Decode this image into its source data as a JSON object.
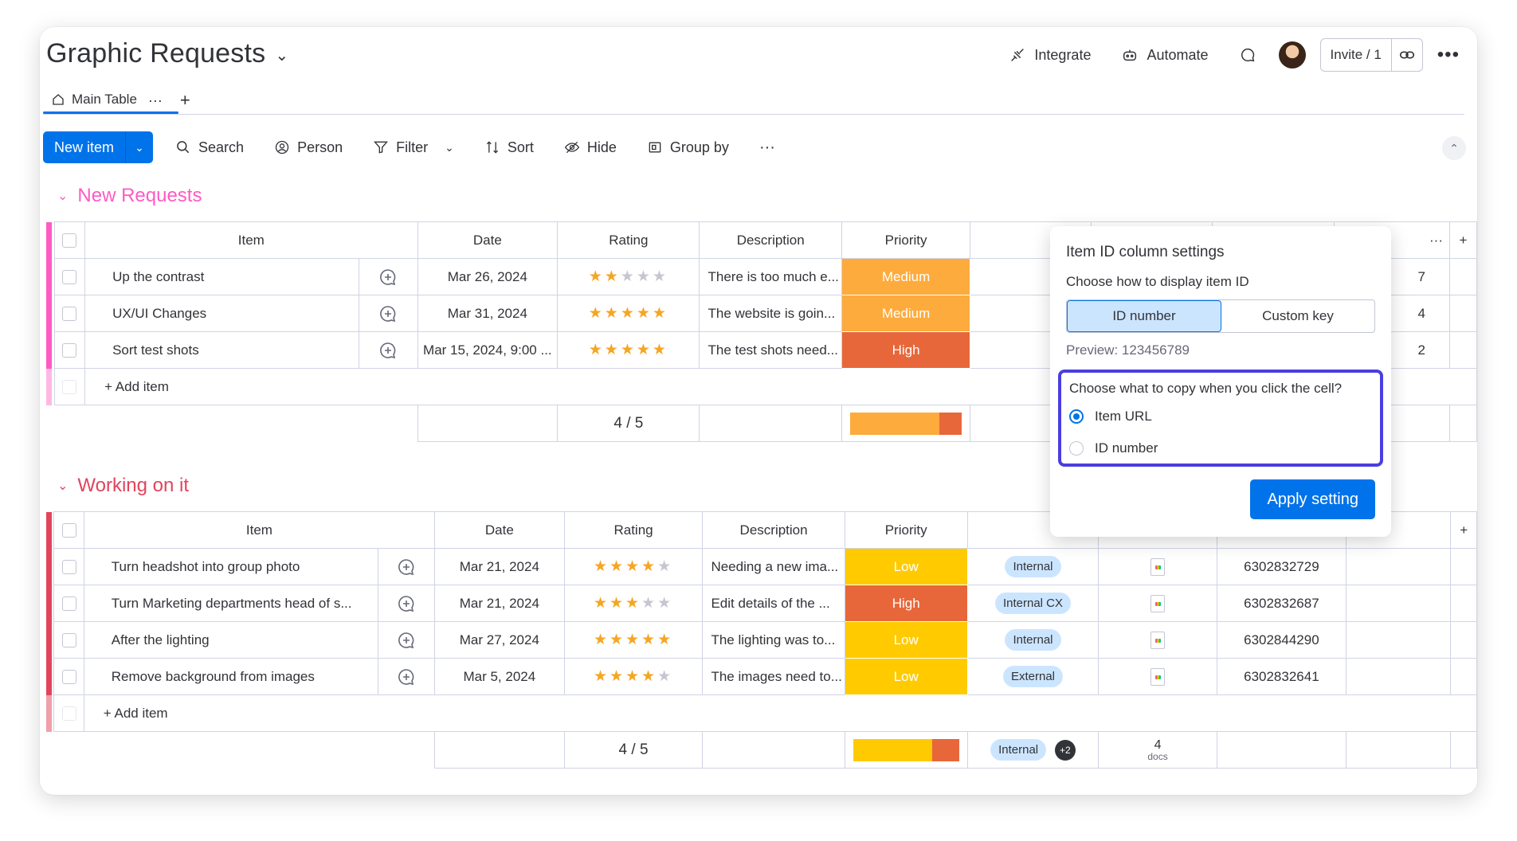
{
  "header": {
    "title": "Graphic Requests",
    "integrate": "Integrate",
    "automate": "Automate",
    "invite": "Invite / 1"
  },
  "tabs": {
    "main": "Main Table",
    "more": "···",
    "add": "+"
  },
  "toolbar": {
    "new_item": "New item",
    "search": "Search",
    "person": "Person",
    "filter": "Filter",
    "sort": "Sort",
    "hide": "Hide",
    "group_by": "Group by",
    "more": "···"
  },
  "columns": {
    "item": "Item",
    "date": "Date",
    "rating": "Rating",
    "description": "Description",
    "priority": "Priority"
  },
  "groups": [
    {
      "title": "New Requests",
      "color": "#e2445c",
      "accent": "#ff5ac4",
      "rows": [
        {
          "item": "Up the contrast",
          "date": "Mar 26, 2024",
          "rating": 2,
          "description": "There is too much e...",
          "priority": "Medium",
          "priority_color": "#fdab3d",
          "id_tail": "7"
        },
        {
          "item": "UX/UI Changes",
          "date": "Mar 31, 2024",
          "rating": 5,
          "description": "The website is goin...",
          "priority": "Medium",
          "priority_color": "#fdab3d",
          "id_tail": "4"
        },
        {
          "item": "Sort test shots",
          "date": "Mar 15, 2024, 9:00 ...",
          "rating": 5,
          "description": "The test shots need...",
          "priority": "High",
          "priority_color": "#e8673a",
          "id_tail": "2"
        }
      ],
      "add_item": "+ Add item",
      "rating_summary": "4 / 5"
    },
    {
      "title": "Working on it",
      "color": "#e2445c",
      "rows": [
        {
          "item": "Turn headshot into group photo",
          "date": "Mar 21, 2024",
          "rating": 4,
          "description": "Needing a new ima...",
          "priority": "Low",
          "priority_color": "#ffcb00",
          "tag": "Internal",
          "item_id": "6302832729"
        },
        {
          "item": "Turn Marketing departments head of s...",
          "date": "Mar 21, 2024",
          "rating": 3,
          "description": "Edit details of the ...",
          "priority": "High",
          "priority_color": "#e8673a",
          "tag": "Internal CX",
          "item_id": "6302832687"
        },
        {
          "item": "After the lighting",
          "date": "Mar 27, 2024",
          "rating": 5,
          "description": "The lighting was to...",
          "priority": "Low",
          "priority_color": "#ffcb00",
          "tag": "Internal",
          "item_id": "6302844290"
        },
        {
          "item": "Remove background from images",
          "date": "Mar 5, 2024",
          "rating": 4,
          "description": "The images need to...",
          "priority": "Low",
          "priority_color": "#ffcb00",
          "tag": "External",
          "item_id": "6302832641"
        }
      ],
      "add_item": "+ Add item",
      "rating_summary": "4 / 5",
      "tag_summary": "Internal",
      "tag_more": "+2",
      "docs_count": "4",
      "docs_label": "docs"
    }
  ],
  "popover": {
    "title": "Item ID column settings",
    "subtitle": "Choose how to display item ID",
    "seg_id": "ID number",
    "seg_custom": "Custom key",
    "preview": "Preview: 123456789",
    "copy_question": "Choose what to copy when you click the cell?",
    "opt_url": "Item URL",
    "opt_id": "ID number",
    "apply": "Apply setting"
  },
  "colors": {
    "accent_blue": "#0073ea",
    "group1": "#ff5ac4",
    "group2": "#e2445c",
    "highlight_border": "#4a3ee0"
  }
}
